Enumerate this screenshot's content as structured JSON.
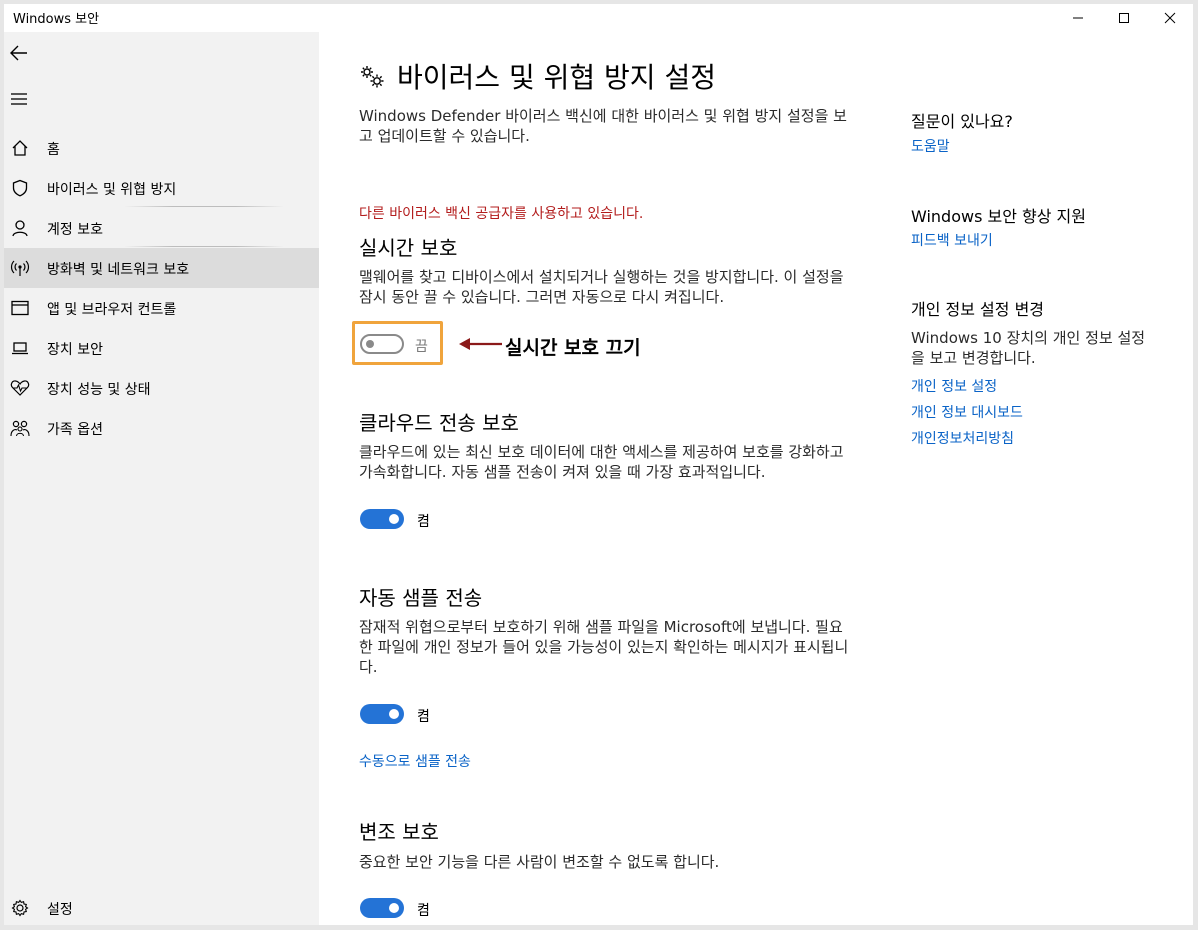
{
  "window": {
    "title": "Windows 보안"
  },
  "sidebar": {
    "items": [
      {
        "label": "홈",
        "icon": "home-icon"
      },
      {
        "label": "바이러스 및 위협 방지",
        "icon": "shield-icon"
      },
      {
        "label": "계정 보호",
        "icon": "person-icon"
      },
      {
        "label": "방화벽 및 네트워크 보호",
        "icon": "wireless-icon",
        "selected": true
      },
      {
        "label": "앱 및 브라우저 컨트롤",
        "icon": "browser-window-icon"
      },
      {
        "label": "장치 보안",
        "icon": "laptop-icon"
      },
      {
        "label": "장치 성능 및 상태",
        "icon": "heart-pulse-icon"
      },
      {
        "label": "가족 옵션",
        "icon": "family-icon"
      }
    ],
    "settings_label": "설정"
  },
  "main": {
    "title": "바이러스 및 위협 방지 설정",
    "intro": "Windows Defender 바이러스 백신에 대한 바이러스 및 위협 방지 설정을 보고 업데이트할 수 있습니다.",
    "warning": "다른 바이러스 백신 공급자를 사용하고 있습니다.",
    "sections": {
      "realtime": {
        "title": "실시간 보호",
        "desc": "맬웨어를 찾고 디바이스에서 설치되거나 실행하는 것을 방지합니다. 이 설정을 잠시 동안 끌 수 있습니다. 그러면 자동으로 다시 켜집니다.",
        "state": "끔",
        "on": false
      },
      "cloud": {
        "title": "클라우드 전송 보호",
        "desc": "클라우드에 있는 최신 보호 데이터에 대한 액세스를 제공하여 보호를 강화하고 가속화합니다. 자동 샘플 전송이 켜져 있을 때 가장 효과적입니다.",
        "state": "켬",
        "on": true
      },
      "sample": {
        "title": "자동 샘플 전송",
        "desc": "잠재적 위협으로부터 보호하기 위해 샘플 파일을 Microsoft에 보냅니다. 필요한 파일에 개인 정보가 들어 있을 가능성이 있는지 확인하는 메시지가 표시됩니다.",
        "state": "켬",
        "on": true,
        "link": "수동으로 샘플 전송"
      },
      "tamper": {
        "title": "변조 보호",
        "desc": "중요한 보안 기능을 다른 사람이 변조할 수 없도록 합니다.",
        "state": "켬",
        "on": true
      }
    },
    "annotation": "실시간 보호 끄기"
  },
  "aside": {
    "help_title": "질문이 있나요?",
    "help_link": "도움말",
    "improve_title": "Windows 보안 향상 지원",
    "feedback_link": "피드백 보내기",
    "privacy_title": "개인 정보 설정 변경",
    "privacy_desc": "Windows 10 장치의 개인 정보 설정을 보고 변경합니다.",
    "privacy_links": [
      "개인 정보 설정",
      "개인 정보 대시보드",
      "개인정보처리방침"
    ]
  },
  "colors": {
    "accent": "#2473d6",
    "link": "#0a63c7",
    "warning": "#b31d1d",
    "highlight": "#f0a43c",
    "arrow": "#8b1a1a"
  }
}
